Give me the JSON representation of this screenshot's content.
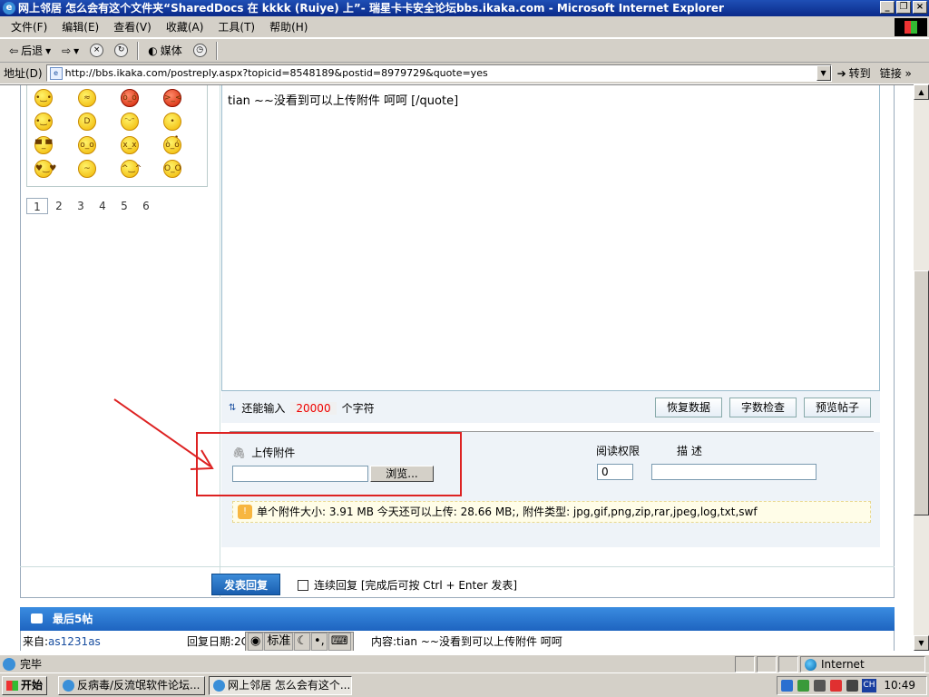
{
  "window": {
    "title": "网上邻居 怎么会有这个文件夹“SharedDocs 在 kkkk (Ruiye) 上”- 瑞星卡卡安全论坛bbs.ikaka.com - Microsoft Internet Explorer",
    "controls": [
      "_",
      "❐",
      "×"
    ]
  },
  "menu": [
    "文件(F)",
    "编辑(E)",
    "查看(V)",
    "收藏(A)",
    "工具(T)",
    "帮助(H)"
  ],
  "toolbar": {
    "back_label": "后退",
    "media_label": "媒体"
  },
  "address": {
    "label": "地址(D)",
    "url": "http://bbs.ikaka.com/postreply.aspx?topicid=8548189&postid=8979729&quote=yes",
    "go_label": "转到",
    "links_label": "链接"
  },
  "emoticon_pages": [
    "1",
    "2",
    "3",
    "4",
    "5",
    "6"
  ],
  "editor": {
    "text": "tian ~~没看到可以上传附件  呵呵  [/quote]"
  },
  "char_info": {
    "prefix": "还能输入",
    "count": "20000",
    "suffix": "个字符"
  },
  "editor_buttons": {
    "restore": "恢复数据",
    "count_check": "字数检查",
    "preview": "预览帖子"
  },
  "attachment": {
    "label": "上传附件",
    "browse_label": "浏览...",
    "permission_label": "阅读权限",
    "permission_value": "0",
    "description_label": "描 述",
    "notice": "单个附件大小: 3.91 MB  今天还可以上传: 28.66 MB;,  附件类型:  jpg,gif,png,zip,rar,jpeg,log,txt,swf"
  },
  "submit": {
    "label": "发表回复",
    "continue_label": "连续回复 [完成后可按 Ctrl + Enter 发表]"
  },
  "last_posts": {
    "title": "最后5帖",
    "from_label": "来自:",
    "from_user": "as1231as",
    "date_label": "回复日期:2C",
    "content": "内容:tian ~~没看到可以上传附件 呵呵"
  },
  "ime": {
    "mode": "标准"
  },
  "status": {
    "text": "完毕",
    "zone": "Internet"
  },
  "taskbar": {
    "start_label": "开始",
    "tasks": [
      "反病毒/反流氓软件论坛...",
      "网上邻居 怎么会有这个..."
    ],
    "tray_lang": "CH",
    "clock": "10:49"
  },
  "colors": {
    "accent": "#1e64c0",
    "highlight_box": "#dd2222",
    "counter": "#ee0000"
  }
}
